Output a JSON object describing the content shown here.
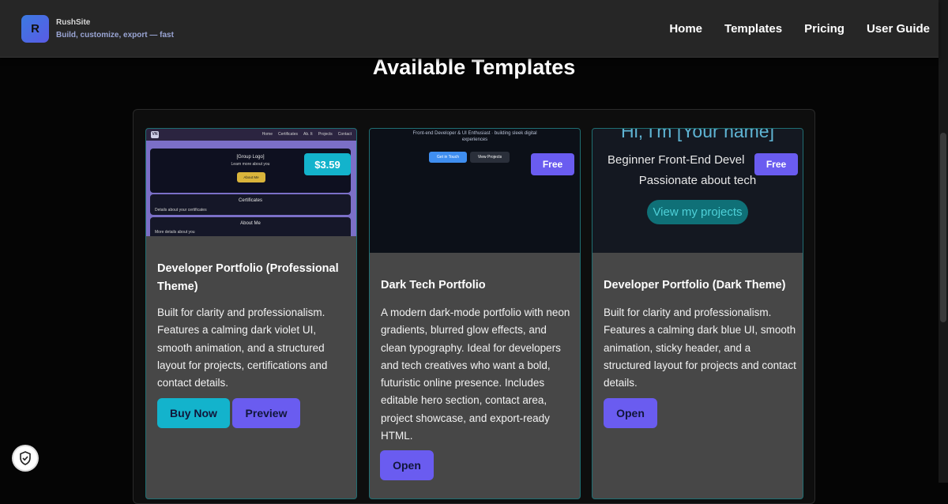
{
  "header": {
    "logo_letter": "R",
    "brand_name": "RushSite",
    "tagline": "Build, customize, export — fast",
    "nav": [
      "Home",
      "Templates",
      "Pricing",
      "User Guide"
    ]
  },
  "page_title": "Available Templates",
  "cards": [
    {
      "title": "Developer Portfolio (Professional Theme)",
      "description": "Built for clarity and professionalism. Features a calming dark violet UI, smooth animation, and a structured layout for projects, certifications and contact details.",
      "badge": "$3.59",
      "buttons": [
        "Buy Now",
        "Preview"
      ],
      "thumb": {
        "logo": "VN",
        "nav": [
          "Home",
          "Certificates",
          "Ab. It",
          "Projects",
          "Contact"
        ],
        "hero_title": "[Group Logo]",
        "hero_sub": "Learn more about you",
        "hero_btn": "About Me",
        "section1": "Certificates",
        "section1_sub": "Details about your certificates",
        "section2": "About Me",
        "section2_sub": "More details about you"
      }
    },
    {
      "title": "Dark Tech Portfolio",
      "description": "A modern dark-mode portfolio with neon gradients, blurred glow effects, and clean typography. Ideal for developers and tech creatives who want a bold, futuristic online presence. Includes editable hero section, contact area, project showcase, and export-ready HTML.",
      "badge": "Free",
      "buttons": [
        "Open"
      ],
      "thumb": {
        "line1": "Front-end Developer & UI Enthusiast · building sleek digital",
        "line2": "experiences",
        "btn1": "Get in Touch",
        "btn2": "View Projects"
      }
    },
    {
      "title": "Developer Portfolio (Dark Theme)",
      "description": "Built for clarity and professionalism. Features a calming dark blue UI, smooth animation, sticky header, and a structured layout for projects and contact details.",
      "badge": "Free",
      "buttons": [
        "Open"
      ],
      "thumb": {
        "heading": "Hi, I'm [Your name]",
        "line1": "Beginner Front-End Devel",
        "line2": "Passionate about tech",
        "btn": "View my projects"
      }
    }
  ],
  "colors": {
    "accent_cyan": "#13b3cc",
    "accent_violet": "#6a5cf0",
    "card_bg": "#474747"
  },
  "icons": {
    "privacy": "shield-check-icon"
  }
}
